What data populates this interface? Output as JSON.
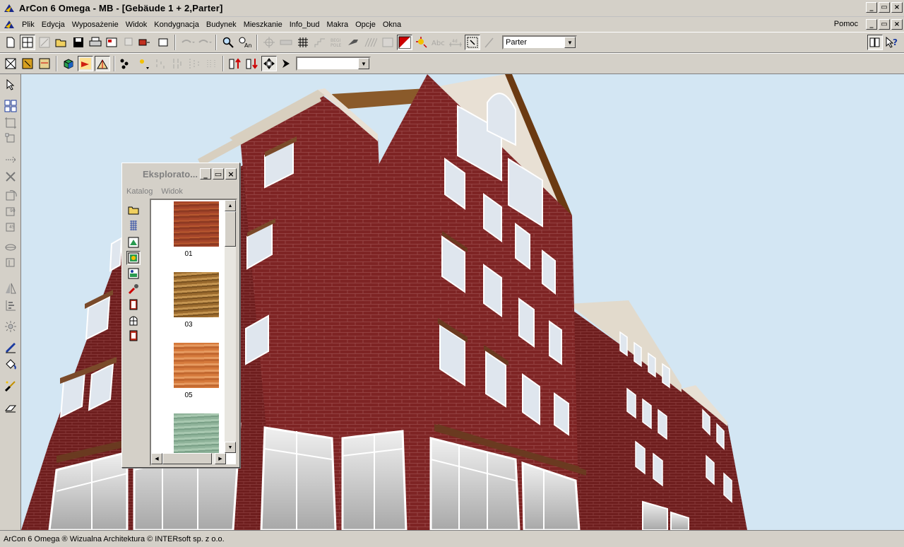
{
  "window": {
    "title": "ArCon 6 Omega - MB - [Gebäude 1 + 2,Parter]",
    "controls": {
      "minimize": "_",
      "maximize": "▭",
      "close": "×"
    }
  },
  "menu": {
    "items": [
      "Plik",
      "Edycja",
      "Wyposażenie",
      "Widok",
      "Kondygnacja",
      "Budynek",
      "Mieszkanie",
      "Info_bud",
      "Makra",
      "Opcje",
      "Okna"
    ],
    "help": "Pomoc"
  },
  "toolbar": {
    "floor_select": "Parter",
    "combo2_value": ""
  },
  "explorer": {
    "title": "Eksplorato...",
    "menu": [
      "Katalog",
      "Widok"
    ],
    "items": [
      {
        "label": "01",
        "color": "#a5452a"
      },
      {
        "label": "03",
        "color": "#9a6a2e"
      },
      {
        "label": "05",
        "color": "#d67a3c"
      },
      {
        "label": "",
        "color": "#8fb39a"
      }
    ]
  },
  "status": {
    "text": "ArCon 6 Omega ® Wizualna Architektura © INTERsoft sp. z o.o."
  },
  "colors": {
    "brick": "#7e2424",
    "sky": "#d3e6f3",
    "trim": "#e8e0d4"
  }
}
